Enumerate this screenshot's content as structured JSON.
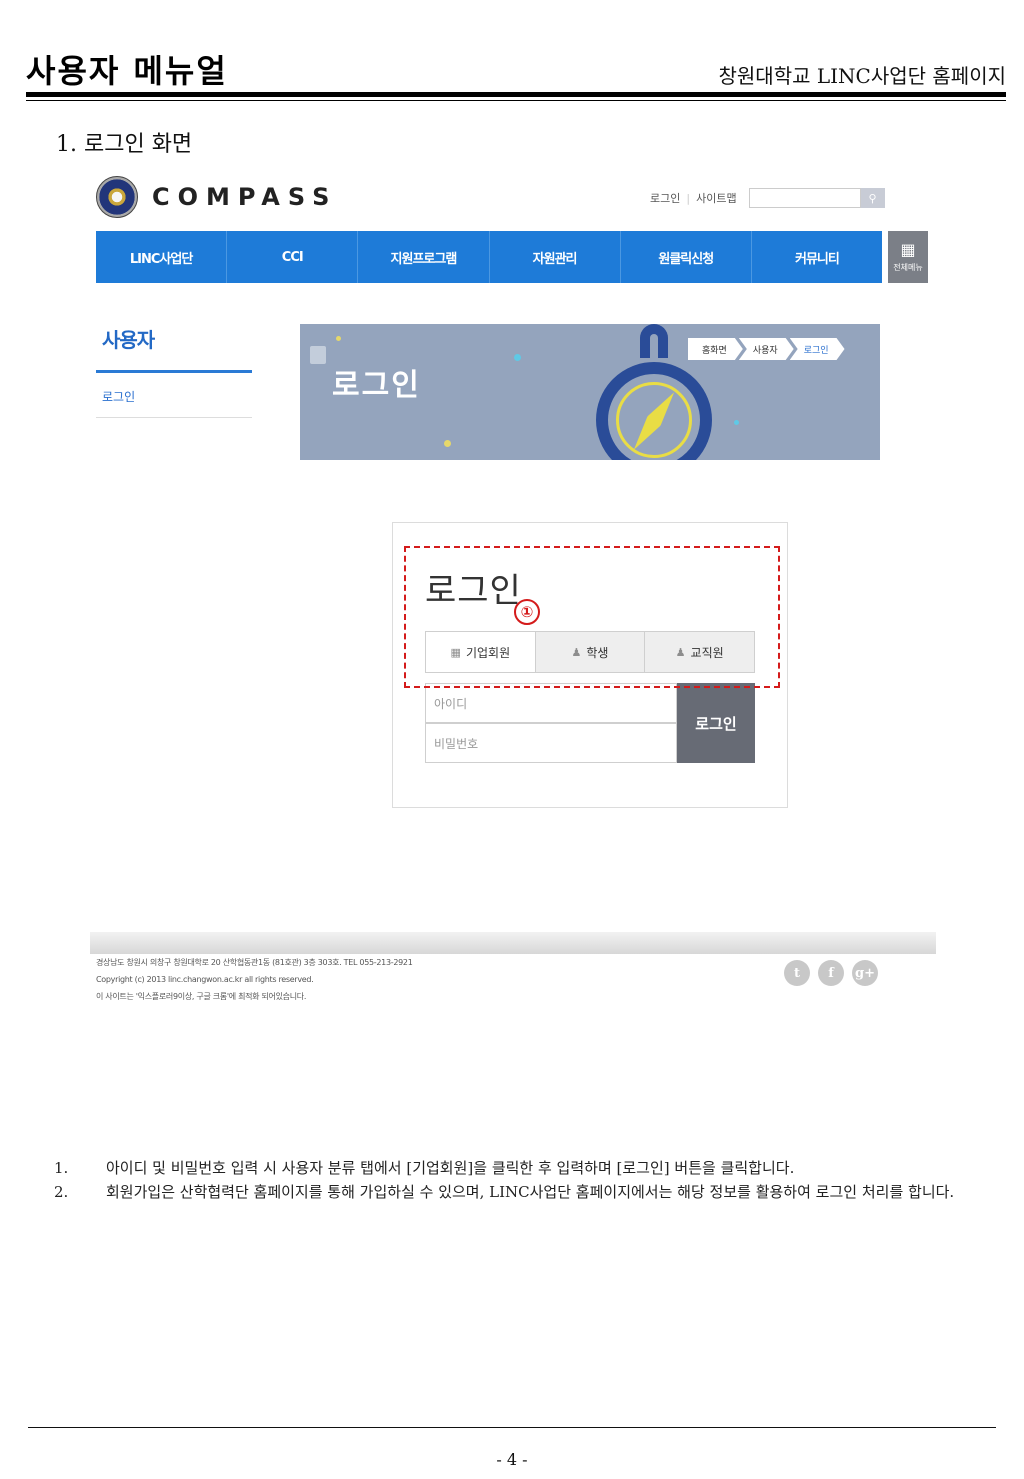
{
  "doc": {
    "title": "사용자 메뉴얼",
    "subtitle": "창원대학교 LINC사업단 홈페이지",
    "section_heading": "1. 로그인 화면",
    "page_number": "- 4 -"
  },
  "site": {
    "logo_text": "COMPASS",
    "util_links": [
      "로그인",
      "사이트맵"
    ],
    "gnb": [
      "LINC사업단",
      "CCI",
      "지원프로그램",
      "자원관리",
      "원클릭신청",
      "커뮤니티"
    ],
    "all_menu_label": "전체메뉴",
    "lnb_title": "사용자",
    "lnb_item": "로그인",
    "banner_title": "로그인",
    "breadcrumb": [
      "홈화면",
      "사용자",
      "로그인"
    ],
    "login": {
      "title": "로그인",
      "tabs": [
        {
          "label": "기업회원",
          "icon": "building-icon"
        },
        {
          "label": "학생",
          "icon": "person-icon"
        },
        {
          "label": "교직원",
          "icon": "person-icon"
        }
      ],
      "id_placeholder": "아이디",
      "pw_placeholder": "비밀번호",
      "button": "로그인"
    },
    "callout_number": "①",
    "footer_lines": [
      "경상남도 창원시 의창구 창원대학로 20 산학협동관1동 (81호관) 3층 303호. TEL 055-213-2921",
      "Copyright (c) 2013 linc.changwon.ac.kr all rights reserved.",
      "이 사이트는 '익스플로러9이상, 구글 크롬'에 최적화 되어있습니다."
    ],
    "social": [
      "t",
      "f",
      "g+"
    ]
  },
  "notes": [
    {
      "num": "1.",
      "text": "아이디 및 비밀번호 입력 시 사용자 분류 탭에서 [기업회원]을 클릭한 후 입력하며 [로그인] 버튼을 클릭합니다."
    },
    {
      "num": "2.",
      "text": "회원가입은 산학협력단 홈페이지를 통해 가입하실 수 있으며, LINC사업단 홈페이지에서는 해당 정보를 활용하여 로그인 처리를 합니다."
    }
  ],
  "colors": {
    "gnb": "#1e7bd8",
    "banner": "#94a4bd",
    "login_button": "#676b75",
    "callout": "#d41b1b"
  }
}
